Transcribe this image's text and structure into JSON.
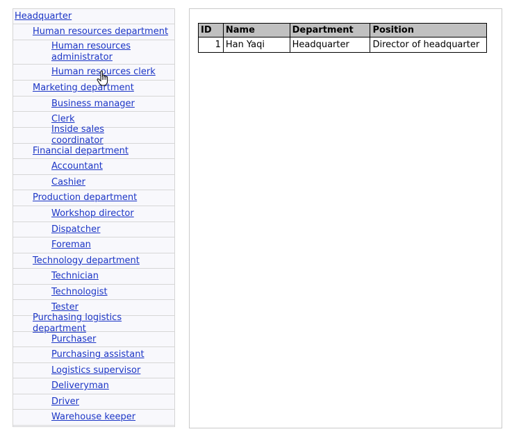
{
  "tree": [
    {
      "label": "Headquarter",
      "level": 0
    },
    {
      "label": "Human resources department",
      "level": 1
    },
    {
      "label": "Human resources administrator",
      "level": 2
    },
    {
      "label": "Human resources clerk",
      "level": 2
    },
    {
      "label": "Marketing department",
      "level": 1
    },
    {
      "label": "Business manager",
      "level": 2
    },
    {
      "label": "Clerk",
      "level": 2
    },
    {
      "label": "Inside sales coordinator",
      "level": 2
    },
    {
      "label": "Financial department",
      "level": 1
    },
    {
      "label": "Accountant",
      "level": 2
    },
    {
      "label": "Cashier",
      "level": 2
    },
    {
      "label": "Production department",
      "level": 1
    },
    {
      "label": "Workshop director",
      "level": 2
    },
    {
      "label": "Dispatcher",
      "level": 2
    },
    {
      "label": "Foreman",
      "level": 2
    },
    {
      "label": "Technology department",
      "level": 1
    },
    {
      "label": "Technician",
      "level": 2
    },
    {
      "label": "Technologist",
      "level": 2
    },
    {
      "label": "Tester",
      "level": 2
    },
    {
      "label": "Purchasing logistics department",
      "level": 1
    },
    {
      "label": "Purchaser",
      "level": 2
    },
    {
      "label": "Purchasing assistant",
      "level": 2
    },
    {
      "label": "Logistics supervisor",
      "level": 2
    },
    {
      "label": "Deliveryman",
      "level": 2
    },
    {
      "label": "Driver",
      "level": 2
    },
    {
      "label": "Warehouse keeper",
      "level": 2
    }
  ],
  "table": {
    "headers": [
      "ID",
      "Name",
      "Department",
      "Position"
    ],
    "rows": [
      [
        "1",
        "Han Yaqi",
        "Headquarter",
        "Director of headquarter"
      ]
    ]
  }
}
